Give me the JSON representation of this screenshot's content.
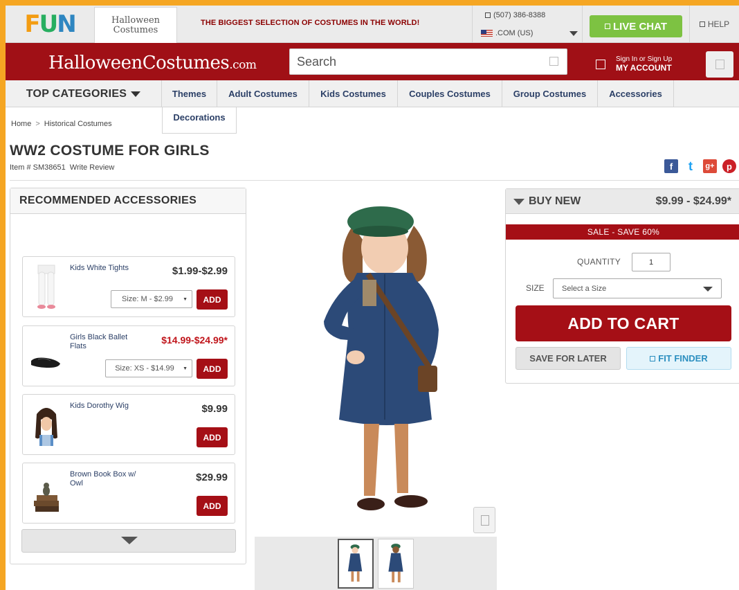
{
  "topbar": {
    "fun_letters": [
      "F",
      "U",
      "N"
    ],
    "hc_logo_line1": "Halloween",
    "hc_logo_line2": "Costumes",
    "tagline": "THE BIGGEST SELECTION OF COSTUMES IN THE WORLD!",
    "phone": "(507) 386-8388",
    "region": ".COM (US)",
    "live_chat": "LIVE CHAT",
    "help": "HELP"
  },
  "header": {
    "logo_main": "HalloweenCostumes",
    "logo_suffix": ".com",
    "search_placeholder": "Search",
    "account_small": "Sign In or Sign Up",
    "account_big": "MY ACCOUNT"
  },
  "nav": {
    "top_categories": "TOP CATEGORIES",
    "items": [
      "Themes",
      "Adult Costumes",
      "Kids Costumes",
      "Couples Costumes",
      "Group Costumes",
      "Accessories",
      "Decorations"
    ]
  },
  "breadcrumb": {
    "home": "Home",
    "separator": ">",
    "category": "Historical Costumes"
  },
  "product": {
    "title": "WW2 COSTUME FOR GIRLS",
    "item_number": "Item # SM38651",
    "write_review": "Write Review"
  },
  "social": {
    "facebook": "f",
    "twitter": "t",
    "gplus": "g+",
    "pinterest": "p"
  },
  "accessories": {
    "heading": "RECOMMENDED ACCESSORIES",
    "add_label": "ADD",
    "items": [
      {
        "name": "Kids White Tights",
        "price": "$1.99-$2.99",
        "size": "Size: M - $2.99"
      },
      {
        "name": "Girls Black Ballet Flats",
        "price": "$14.99-$24.99*",
        "size": "Size: XS - $14.99"
      },
      {
        "name": "Kids Dorothy Wig",
        "price": "$9.99",
        "size": ""
      },
      {
        "name": "Brown Book Box w/ Owl",
        "price": "$29.99",
        "size": ""
      }
    ]
  },
  "buybox": {
    "heading": "BUY NEW",
    "price_range": "$9.99 - $24.99*",
    "sale_text": "SALE - SAVE 60%",
    "quantity_label": "QUANTITY",
    "quantity_value": "1",
    "size_label": "SIZE",
    "size_placeholder": "Select a Size",
    "add_to_cart": "ADD TO CART",
    "save_for_later": "SAVE FOR LATER",
    "fit_finder": "FIT FINDER"
  },
  "colors": {
    "brand_red": "#a01016",
    "button_red": "#a50f16",
    "live_chat_green": "#7dc242",
    "nav_text": "#2b3f66",
    "page_border": "#f5a623"
  },
  "icons": [
    "search-icon",
    "account-icon",
    "cart-icon",
    "chat-icon",
    "help-icon",
    "phone-icon",
    "zoom-icon",
    "chevron-down-icon"
  ]
}
